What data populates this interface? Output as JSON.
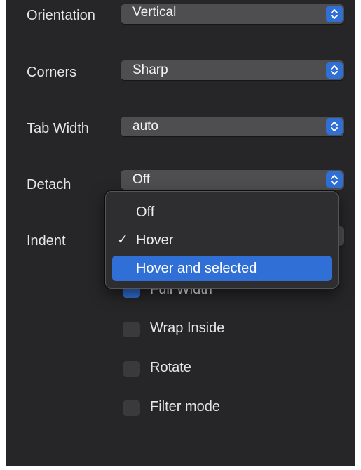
{
  "settings": {
    "orientation": {
      "label": "Orientation",
      "value": "Vertical"
    },
    "corners": {
      "label": "Corners",
      "value": "Sharp"
    },
    "tab_width": {
      "label": "Tab Width",
      "value": "auto"
    },
    "detach": {
      "label": "Detach",
      "value": "Off"
    },
    "indent": {
      "label": "Indent"
    }
  },
  "dropdown_menu": {
    "items": [
      {
        "label": "Off",
        "checked": false,
        "highlighted": false
      },
      {
        "label": "Hover",
        "check_mark": "✓",
        "checked": true,
        "highlighted": false
      },
      {
        "label": "Hover and selected",
        "checked": false,
        "highlighted": true
      }
    ]
  },
  "checkboxes": [
    {
      "label": "Full Width",
      "checked": true
    },
    {
      "label": "Wrap Inside",
      "checked": false
    },
    {
      "label": "Rotate",
      "checked": false
    },
    {
      "label": "Filter mode",
      "checked": false
    }
  ],
  "colors": {
    "panel_background": "#262628",
    "control_background": "#4e4e50",
    "accent": "#2f6fd6",
    "text": "#e6e6e6"
  }
}
